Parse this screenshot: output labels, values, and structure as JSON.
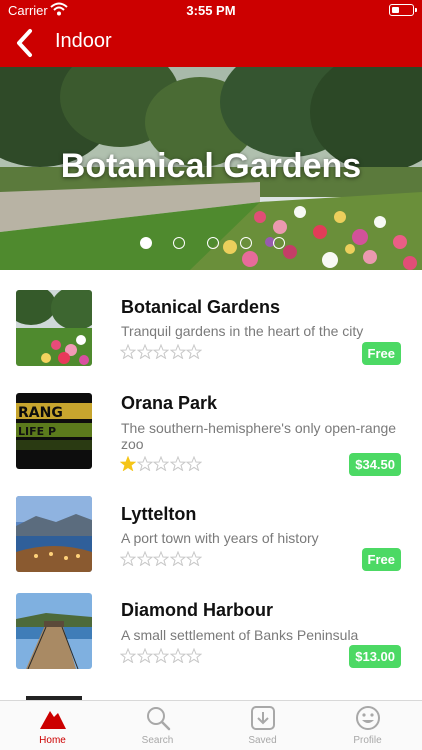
{
  "status": {
    "carrier": "Carrier",
    "time": "3:55 PM"
  },
  "nav": {
    "title": "Indoor",
    "back_icon": "chevron-left-icon"
  },
  "hero": {
    "title": "Botanical Gardens",
    "slides": 5,
    "active_slide": 1
  },
  "places": [
    {
      "name": "Botanical Gardens",
      "description": "Tranquil gardens in the heart of the city",
      "rating": 0,
      "price": "Free"
    },
    {
      "name": "Orana Park",
      "description": "The southern-hemisphere's only open-range zoo",
      "rating": 1,
      "price": "$34.50"
    },
    {
      "name": "Lyttelton",
      "description": "A port town with years of history",
      "rating": 0,
      "price": "Free"
    },
    {
      "name": "Diamond Harbour",
      "description": "A small settlement of Banks Peninsula",
      "rating": 0,
      "price": "$13.00"
    }
  ],
  "tabs": [
    {
      "label": "Home",
      "icon": "mountain-icon",
      "active": true
    },
    {
      "label": "Search",
      "icon": "search-icon",
      "active": false
    },
    {
      "label": "Saved",
      "icon": "download-icon",
      "active": false
    },
    {
      "label": "Profile",
      "icon": "smiley-icon",
      "active": false
    }
  ],
  "colors": {
    "brand": "#cc0000",
    "price_badge": "#4cd964",
    "star_filled": "#f5c518",
    "star_empty": "#c8c8c8",
    "tab_inactive": "#a8a8a8"
  }
}
